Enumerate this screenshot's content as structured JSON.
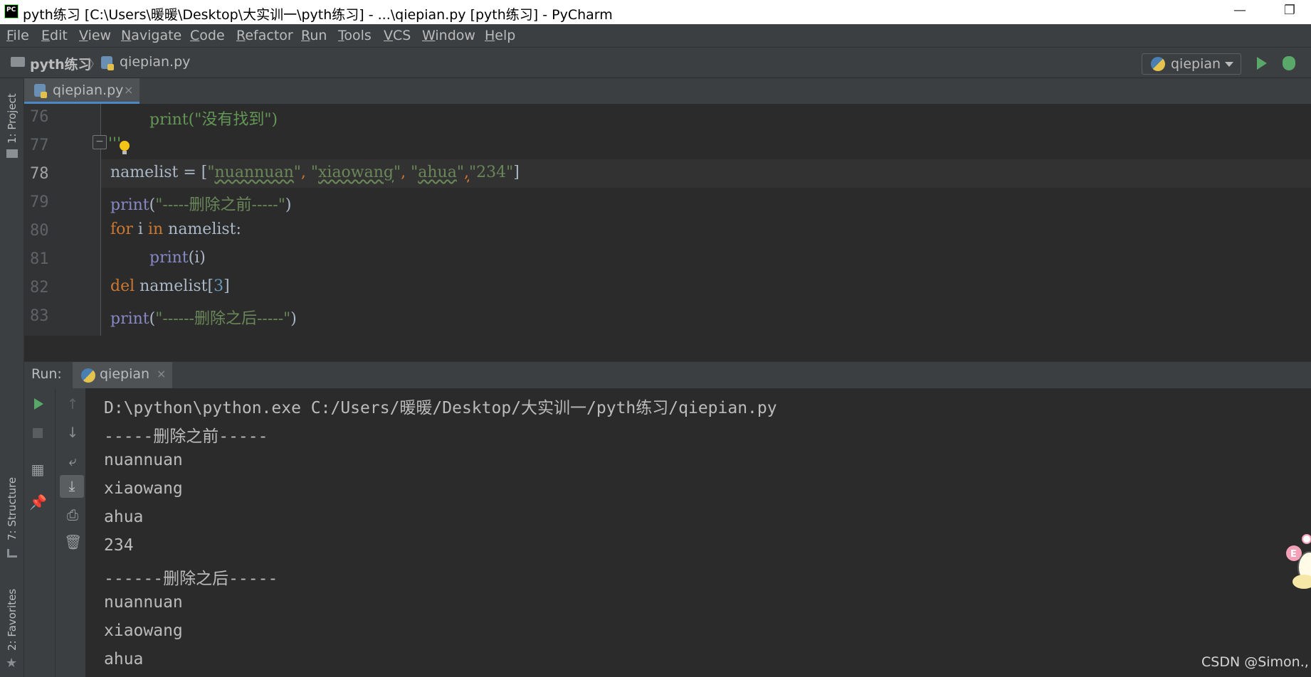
{
  "window": {
    "title": "pyth练习 [C:\\Users\\暖暖\\Desktop\\大实训一\\pyth练习] - ...\\qiepian.py [pyth练习] - PyCharm",
    "minimize_glyph": "—",
    "maximize_glyph": "❐"
  },
  "menu": [
    "File",
    "Edit",
    "View",
    "Navigate",
    "Code",
    "Refactor",
    "Run",
    "Tools",
    "VCS",
    "Window",
    "Help"
  ],
  "breadcrumb": {
    "project": "pyth练习",
    "separator": "〉",
    "file": "qiepian.py"
  },
  "run_config": {
    "name": "qiepian"
  },
  "left_strip": {
    "project_label": "1: Project",
    "structure_label": "7: Structure",
    "favorites_label": "2: Favorites"
  },
  "editor_tab": {
    "label": "qiepian.py",
    "close": "×"
  },
  "editor": {
    "line_numbers": [
      "76",
      "77",
      "78",
      "79",
      "80",
      "81",
      "82",
      "83"
    ],
    "current_line": "78",
    "code": {
      "l76_print": "print(",
      "l76_str": "\"没有找到\"",
      "l76_close": ")",
      "l77_doc": "'''",
      "l78_name": "namelist = [",
      "l78_q1": "\"",
      "l78_s1": "nuannuan",
      "l78_q1e": "\"",
      "l78_c1": ", ",
      "l78_q2": "\"",
      "l78_s2": "xiaowang",
      "l78_q2e": "\"",
      "l78_c2": ", ",
      "l78_q3": "\"",
      "l78_s3": "ahua",
      "l78_q3e": "\"",
      "l78_c3": ",",
      "l78_s4": "\"234\"",
      "l78_end": "]",
      "l79_print": "print",
      "l79_open": "(",
      "l79_str": "\"-----删除之前-----\"",
      "l79_close": ")",
      "l80_for": "for",
      "l80_i": " i ",
      "l80_in": "in",
      "l80_rest": " namelist:",
      "l81_print": "print",
      "l81_rest": "(i)",
      "l82_del": "del",
      "l82_mid": " namelist[",
      "l82_num": "3",
      "l82_end": "]",
      "l83_print": "print",
      "l83_open": "(",
      "l83_str": "\"------删除之后-----\"",
      "l83_close": ")"
    }
  },
  "run_panel": {
    "label": "Run:",
    "tab_label": "qiepian",
    "tab_close": "×"
  },
  "console": {
    "lines": [
      "D:\\python\\python.exe C:/Users/暖暖/Desktop/大实训一/pyth练习/qiepian.py",
      "-----删除之前-----",
      "nuannuan",
      "xiaowang",
      "ahua",
      "234",
      "------删除之后-----",
      "nuannuan",
      "xiaowang",
      "ahua"
    ]
  },
  "watermark": "CSDN @Simon.,",
  "icons": {
    "rerun": "play-icon",
    "stop": "stop-icon",
    "up": "arrow-up-icon",
    "down": "arrow-down-icon",
    "wrap": "soft-wrap-icon",
    "scroll_end": "scroll-to-end-icon",
    "print": "print-icon",
    "trash": "trash-icon",
    "layout": "layout-icon",
    "pin": "pin-icon"
  }
}
